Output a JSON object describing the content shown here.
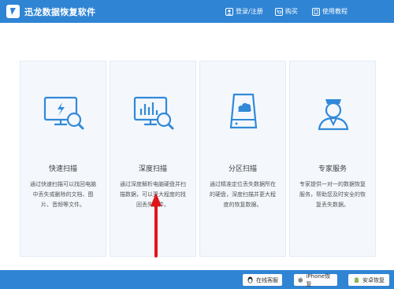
{
  "app": {
    "title": "迅龙数据恢复软件"
  },
  "nav": {
    "login": "登录/注册",
    "buy": "购买",
    "tutorial": "使用教程"
  },
  "modes": [
    {
      "name": "快速扫描",
      "desc": "通过快速扫描可以找回电脑中丢失或删除的文档、图片、音频等文件。",
      "icon": "monitor-search-icon"
    },
    {
      "name": "深度扫描",
      "desc": "通过深度解析电脑硬盘并扫描数据，可以更大程度的找回丢失文件。",
      "icon": "chart-search-icon"
    },
    {
      "name": "分区扫描",
      "desc": "通过精准定位丢失数据所在的硬盘，深度扫描并更大程度的恢复数据。",
      "icon": "harddisk-cloud-icon"
    },
    {
      "name": "专家服务",
      "desc": "专家提供一对一的数据恢复服务，帮助您及时安全的恢复丢失数据。",
      "icon": "expert-person-icon"
    }
  ],
  "footer": {
    "online_service": "在线客服",
    "iphone_recovery": "iPhone恢复",
    "android_recovery": "安卓恢复"
  },
  "colors": {
    "brand": "#2f84d4",
    "icon_blue": "#3289d8",
    "arrow_red": "#e0151a"
  }
}
